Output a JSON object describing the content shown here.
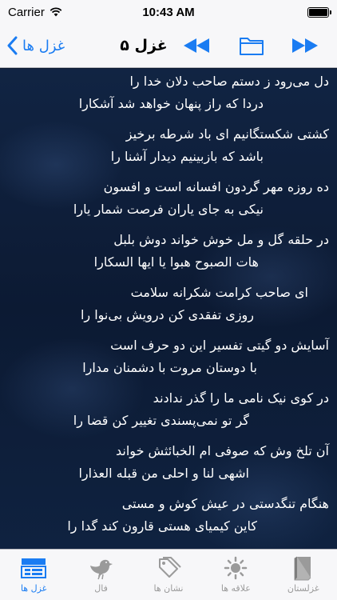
{
  "status_bar": {
    "carrier": "Carrier",
    "time": "10:43 AM"
  },
  "nav": {
    "back_label": "غزل ها",
    "title": "غزل ۵",
    "accent_color": "#1a7cf2",
    "icons": [
      "chevron-left-icon",
      "rewind-icon",
      "folder-icon",
      "fast-forward-icon"
    ]
  },
  "poem": {
    "couplets": [
      {
        "first": "دل می‌رود ز دستم صاحب دلان خدا را",
        "second": "دردا که راز پنهان خواهد شد آشکارا"
      },
      {
        "first": "کشتی شکستگانیم ای باد شرطه برخیز",
        "second": "باشد که بازبینیم دیدار آشنا را"
      },
      {
        "first": "ده روزه مهر گردون افسانه است و افسون",
        "second": "نیکی به جای یاران فرصت شمار یارا"
      },
      {
        "first": "در حلقه گل و مل خوش خواند دوش بلبل",
        "second": "هات الصبوح هبوا یا ایها السکارا"
      },
      {
        "first": "ای صاحب کرامت شکرانه سلامت",
        "second": "روزی تفقدی کن درویش بی‌نوا را"
      },
      {
        "first": "آسایش دو گیتی تفسیر این دو حرف است",
        "second": "با دوستان مروت با دشمنان مدارا"
      },
      {
        "first": "در کوی نیک نامی ما را گذر ندادند",
        "second": "گر تو نمی‌پسندی تغییر کن قضا را"
      },
      {
        "first": "آن تلخ وش که صوفی ام الخبائثش خواند",
        "second": "اشهی لنا و احلی من قبله العذارا"
      },
      {
        "first": "هنگام تنگدستی در عیش کوش و مستی",
        "second": "کاین کیمیای هستی قارون کند گدا را"
      }
    ]
  },
  "tabs": [
    {
      "label": "غزل ها",
      "icon": "list-icon",
      "active": true
    },
    {
      "label": "فال",
      "icon": "bird-icon",
      "active": false
    },
    {
      "label": "نشان ها",
      "icon": "tags-icon",
      "active": false
    },
    {
      "label": "علاقه ها",
      "icon": "sun-icon",
      "active": false
    },
    {
      "label": "غزلستان",
      "icon": "book-icon",
      "active": false
    }
  ]
}
